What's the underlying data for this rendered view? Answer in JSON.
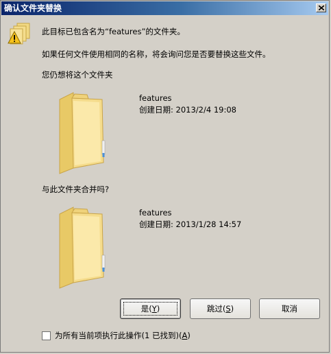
{
  "window": {
    "title": "确认文件夹替换"
  },
  "message": {
    "line1": "此目标已包含名为“features”的文件夹。",
    "line2": "如果任何文件使用相同的名称，将会询问您是否要替换这些文件。",
    "question": "您仍想将这个文件夹"
  },
  "source_folder": {
    "name": "features",
    "date": "创建日期: 2013/2/4 19:08"
  },
  "merge": {
    "question": "与此文件夹合并吗?"
  },
  "target_folder": {
    "name": "features",
    "date": "创建日期: 2013/1/28 14:57"
  },
  "buttons": {
    "yes_text": "是(",
    "yes_key": "Y",
    "yes_close": ")",
    "skip_text": "跳过(",
    "skip_key": "S",
    "skip_close": ")",
    "cancel": "取消"
  },
  "checkbox": {
    "text": "为所有当前项执行此操作(1 已找到)(",
    "key": "A",
    "close": ")",
    "checked": false
  },
  "colors": {
    "title_start": "#0a246a",
    "title_end": "#a6caf0",
    "folder": "#f5dc8c",
    "dialog_bg": "#d4d0c8"
  }
}
